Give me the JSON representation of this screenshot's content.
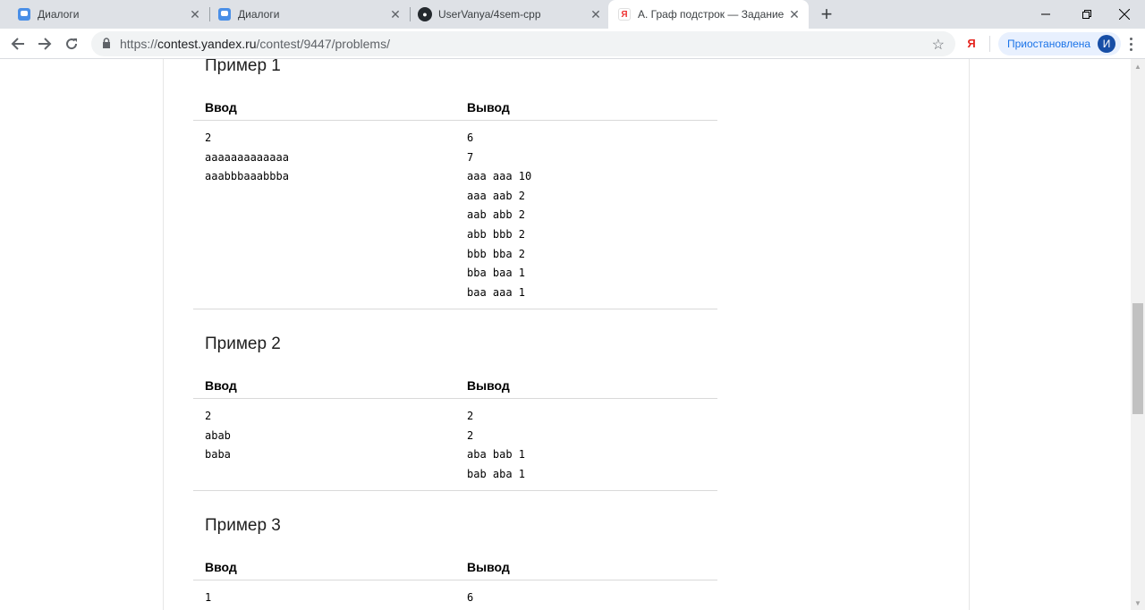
{
  "tabs": [
    {
      "title": "Диалоги",
      "icon": "chat-icon"
    },
    {
      "title": "Диалоги",
      "icon": "chat-icon"
    },
    {
      "title": "UserVanya/4sem-cpp",
      "icon": "github-icon"
    },
    {
      "title": "A. Граф подстрок — Задание на",
      "icon": "yandex-icon"
    }
  ],
  "toolbar": {
    "url_scheme": "https://",
    "url_host": "contest.yandex.ru",
    "url_path": "/contest/9447/problems/",
    "yandex_label": "Я",
    "profile_status": "Приостановлена",
    "avatar_letter": "И"
  },
  "examples": [
    {
      "title": "Пример 1",
      "input_header": "Ввод",
      "output_header": "Вывод",
      "input": [
        "2",
        "aaaaaaaaaaaaa",
        "aaabbbaaabbba"
      ],
      "output": [
        "6",
        "7",
        "aaa aaa 10",
        "aaa aab 2",
        "aab abb 2",
        "abb bbb 2",
        "bbb bba 2",
        "bba baa 1",
        "baa aaa 1"
      ]
    },
    {
      "title": "Пример 2",
      "input_header": "Ввод",
      "output_header": "Вывод",
      "input": [
        "2",
        "abab",
        "baba"
      ],
      "output": [
        "2",
        "2",
        "aba bab 1",
        "bab aba 1"
      ]
    },
    {
      "title": "Пример 3",
      "input_header": "Ввод",
      "output_header": "Вывод",
      "input": [
        "1"
      ],
      "output": [
        "6"
      ]
    }
  ]
}
